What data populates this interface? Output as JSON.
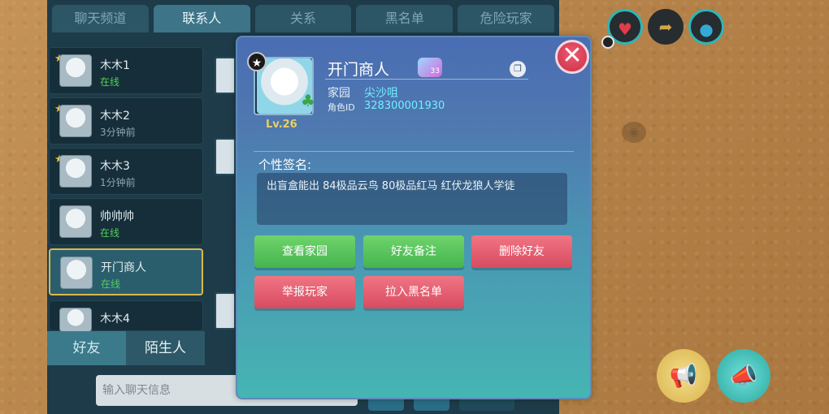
{
  "chat_panel": {
    "tabs": [
      "聊天频道",
      "联系人",
      "关系",
      "黑名单",
      "危险玩家"
    ],
    "active_tab": 1,
    "friends": [
      {
        "name": "木木1",
        "status": "在线",
        "online": true,
        "starred": true
      },
      {
        "name": "木木2",
        "status": "3分钟前",
        "online": false,
        "starred": true
      },
      {
        "name": "木木3",
        "status": "1分钟前",
        "online": false,
        "starred": true
      },
      {
        "name": "帅帅帅",
        "status": "在线",
        "online": true,
        "starred": false
      },
      {
        "name": "开门商人",
        "status": "在线",
        "online": true,
        "starred": false,
        "selected": true
      },
      {
        "name": "木木4",
        "status": "",
        "online": false,
        "starred": false
      }
    ],
    "bottom_tabs": [
      "好友",
      "陌生人"
    ],
    "chat_input_placeholder": "输入聊天信息"
  },
  "profile_dialog": {
    "player_name": "开门商人",
    "vip_level": "33",
    "level": "Lv.26",
    "home_label": "家园",
    "home_value": "尖沙咀",
    "role_id_label": "角色ID",
    "role_id_value": "328300001930",
    "signature_title": "个性签名:",
    "signature_text": "出盲盒能出  84极品云鸟   80极品红马   红伏龙狼人学徒",
    "buttons": {
      "view_home": "查看家园",
      "friend_note": "好友备注",
      "delete_friend": "删除好友",
      "report_player": "举报玩家",
      "add_blacklist": "拉入黑名单"
    }
  },
  "colors": {
    "online": "#4fd05b",
    "accent_cyan": "#6ff0ff",
    "green_button": "#45b44f",
    "red_button": "#d84b61",
    "level_gold": "#e8d062"
  }
}
